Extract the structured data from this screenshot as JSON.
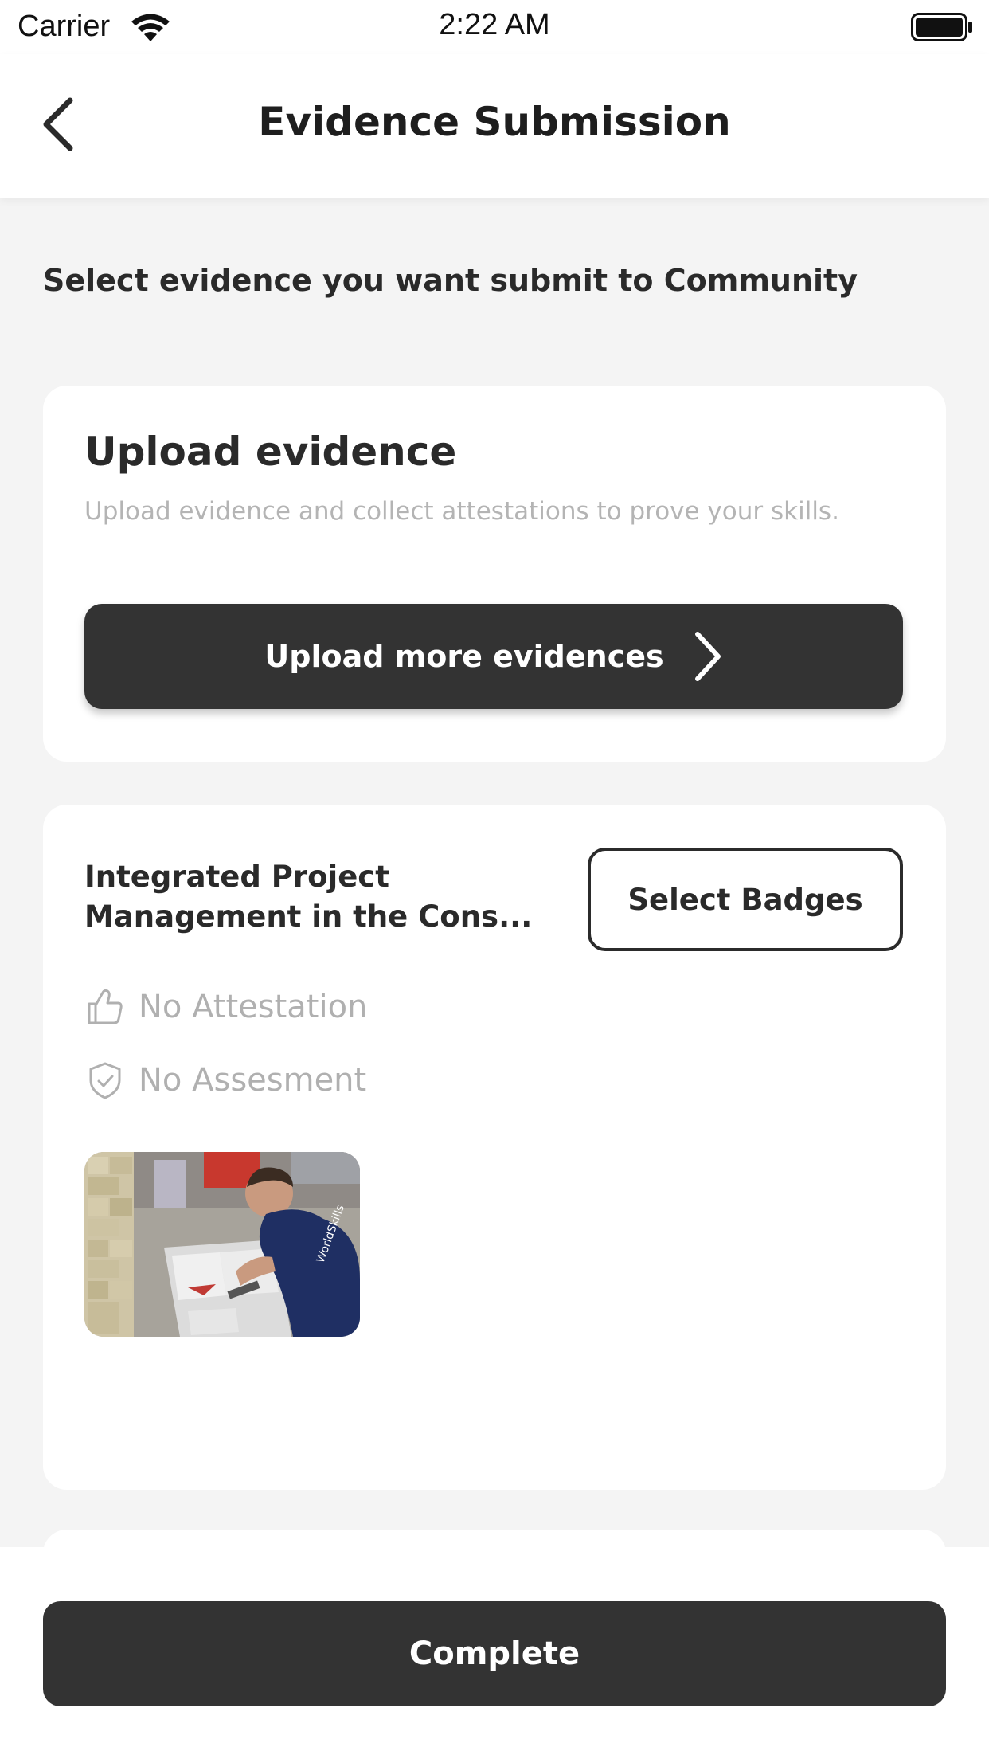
{
  "status_bar": {
    "carrier": "Carrier",
    "time": "2:22 AM"
  },
  "nav": {
    "title": "Evidence Submission"
  },
  "prompt": "Select evidence you want submit to Community",
  "upload_card": {
    "title": "Upload evidence",
    "description": "Upload evidence and collect attestations to prove your skills.",
    "button_label": "Upload more evidences"
  },
  "evidence_item": {
    "title": "Integrated Project Management in the Cons...",
    "select_badges_label": "Select Badges",
    "attestation_status": "No Attestation",
    "assessment_status": "No Assesment"
  },
  "footer": {
    "complete_label": "Complete"
  },
  "icons": {
    "back": "chevron-left-icon",
    "upload_arrow": "chevron-right-icon",
    "attestation": "thumbs-up-icon",
    "assessment": "shield-check-icon",
    "wifi": "wifi-icon",
    "battery": "battery-icon"
  },
  "colors": {
    "primary_dark": "#333333",
    "muted_text": "#b0b0b0",
    "background": "#f4f4f4"
  }
}
